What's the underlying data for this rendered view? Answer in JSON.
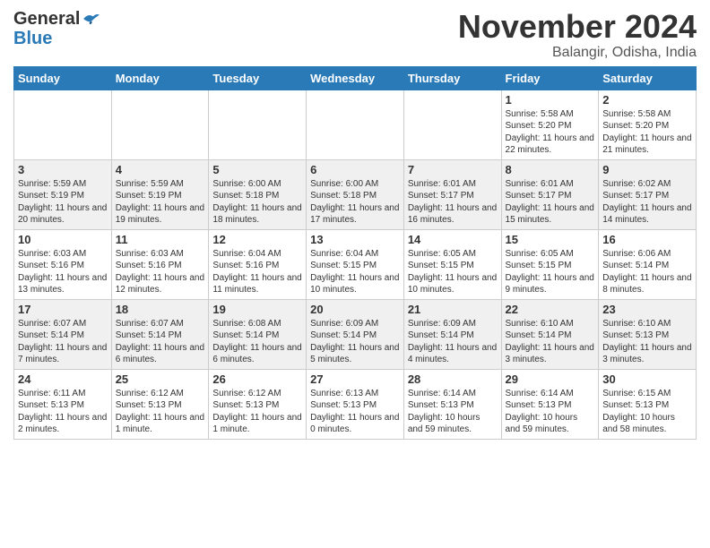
{
  "header": {
    "logo_general": "General",
    "logo_blue": "Blue",
    "month_title": "November 2024",
    "subtitle": "Balangir, Odisha, India"
  },
  "columns": [
    "Sunday",
    "Monday",
    "Tuesday",
    "Wednesday",
    "Thursday",
    "Friday",
    "Saturday"
  ],
  "weeks": [
    [
      {
        "day": "",
        "detail": ""
      },
      {
        "day": "",
        "detail": ""
      },
      {
        "day": "",
        "detail": ""
      },
      {
        "day": "",
        "detail": ""
      },
      {
        "day": "",
        "detail": ""
      },
      {
        "day": "1",
        "detail": "Sunrise: 5:58 AM\nSunset: 5:20 PM\nDaylight: 11 hours\nand 22 minutes."
      },
      {
        "day": "2",
        "detail": "Sunrise: 5:58 AM\nSunset: 5:20 PM\nDaylight: 11 hours\nand 21 minutes."
      }
    ],
    [
      {
        "day": "3",
        "detail": "Sunrise: 5:59 AM\nSunset: 5:19 PM\nDaylight: 11 hours\nand 20 minutes."
      },
      {
        "day": "4",
        "detail": "Sunrise: 5:59 AM\nSunset: 5:19 PM\nDaylight: 11 hours\nand 19 minutes."
      },
      {
        "day": "5",
        "detail": "Sunrise: 6:00 AM\nSunset: 5:18 PM\nDaylight: 11 hours\nand 18 minutes."
      },
      {
        "day": "6",
        "detail": "Sunrise: 6:00 AM\nSunset: 5:18 PM\nDaylight: 11 hours\nand 17 minutes."
      },
      {
        "day": "7",
        "detail": "Sunrise: 6:01 AM\nSunset: 5:17 PM\nDaylight: 11 hours\nand 16 minutes."
      },
      {
        "day": "8",
        "detail": "Sunrise: 6:01 AM\nSunset: 5:17 PM\nDaylight: 11 hours\nand 15 minutes."
      },
      {
        "day": "9",
        "detail": "Sunrise: 6:02 AM\nSunset: 5:17 PM\nDaylight: 11 hours\nand 14 minutes."
      }
    ],
    [
      {
        "day": "10",
        "detail": "Sunrise: 6:03 AM\nSunset: 5:16 PM\nDaylight: 11 hours\nand 13 minutes."
      },
      {
        "day": "11",
        "detail": "Sunrise: 6:03 AM\nSunset: 5:16 PM\nDaylight: 11 hours\nand 12 minutes."
      },
      {
        "day": "12",
        "detail": "Sunrise: 6:04 AM\nSunset: 5:16 PM\nDaylight: 11 hours\nand 11 minutes."
      },
      {
        "day": "13",
        "detail": "Sunrise: 6:04 AM\nSunset: 5:15 PM\nDaylight: 11 hours\nand 10 minutes."
      },
      {
        "day": "14",
        "detail": "Sunrise: 6:05 AM\nSunset: 5:15 PM\nDaylight: 11 hours\nand 10 minutes."
      },
      {
        "day": "15",
        "detail": "Sunrise: 6:05 AM\nSunset: 5:15 PM\nDaylight: 11 hours\nand 9 minutes."
      },
      {
        "day": "16",
        "detail": "Sunrise: 6:06 AM\nSunset: 5:14 PM\nDaylight: 11 hours\nand 8 minutes."
      }
    ],
    [
      {
        "day": "17",
        "detail": "Sunrise: 6:07 AM\nSunset: 5:14 PM\nDaylight: 11 hours\nand 7 minutes."
      },
      {
        "day": "18",
        "detail": "Sunrise: 6:07 AM\nSunset: 5:14 PM\nDaylight: 11 hours\nand 6 minutes."
      },
      {
        "day": "19",
        "detail": "Sunrise: 6:08 AM\nSunset: 5:14 PM\nDaylight: 11 hours\nand 6 minutes."
      },
      {
        "day": "20",
        "detail": "Sunrise: 6:09 AM\nSunset: 5:14 PM\nDaylight: 11 hours\nand 5 minutes."
      },
      {
        "day": "21",
        "detail": "Sunrise: 6:09 AM\nSunset: 5:14 PM\nDaylight: 11 hours\nand 4 minutes."
      },
      {
        "day": "22",
        "detail": "Sunrise: 6:10 AM\nSunset: 5:14 PM\nDaylight: 11 hours\nand 3 minutes."
      },
      {
        "day": "23",
        "detail": "Sunrise: 6:10 AM\nSunset: 5:13 PM\nDaylight: 11 hours\nand 3 minutes."
      }
    ],
    [
      {
        "day": "24",
        "detail": "Sunrise: 6:11 AM\nSunset: 5:13 PM\nDaylight: 11 hours\nand 2 minutes."
      },
      {
        "day": "25",
        "detail": "Sunrise: 6:12 AM\nSunset: 5:13 PM\nDaylight: 11 hours\nand 1 minute."
      },
      {
        "day": "26",
        "detail": "Sunrise: 6:12 AM\nSunset: 5:13 PM\nDaylight: 11 hours\nand 1 minute."
      },
      {
        "day": "27",
        "detail": "Sunrise: 6:13 AM\nSunset: 5:13 PM\nDaylight: 11 hours\nand 0 minutes."
      },
      {
        "day": "28",
        "detail": "Sunrise: 6:14 AM\nSunset: 5:13 PM\nDaylight: 10 hours\nand 59 minutes."
      },
      {
        "day": "29",
        "detail": "Sunrise: 6:14 AM\nSunset: 5:13 PM\nDaylight: 10 hours\nand 59 minutes."
      },
      {
        "day": "30",
        "detail": "Sunrise: 6:15 AM\nSunset: 5:13 PM\nDaylight: 10 hours\nand 58 minutes."
      }
    ]
  ]
}
